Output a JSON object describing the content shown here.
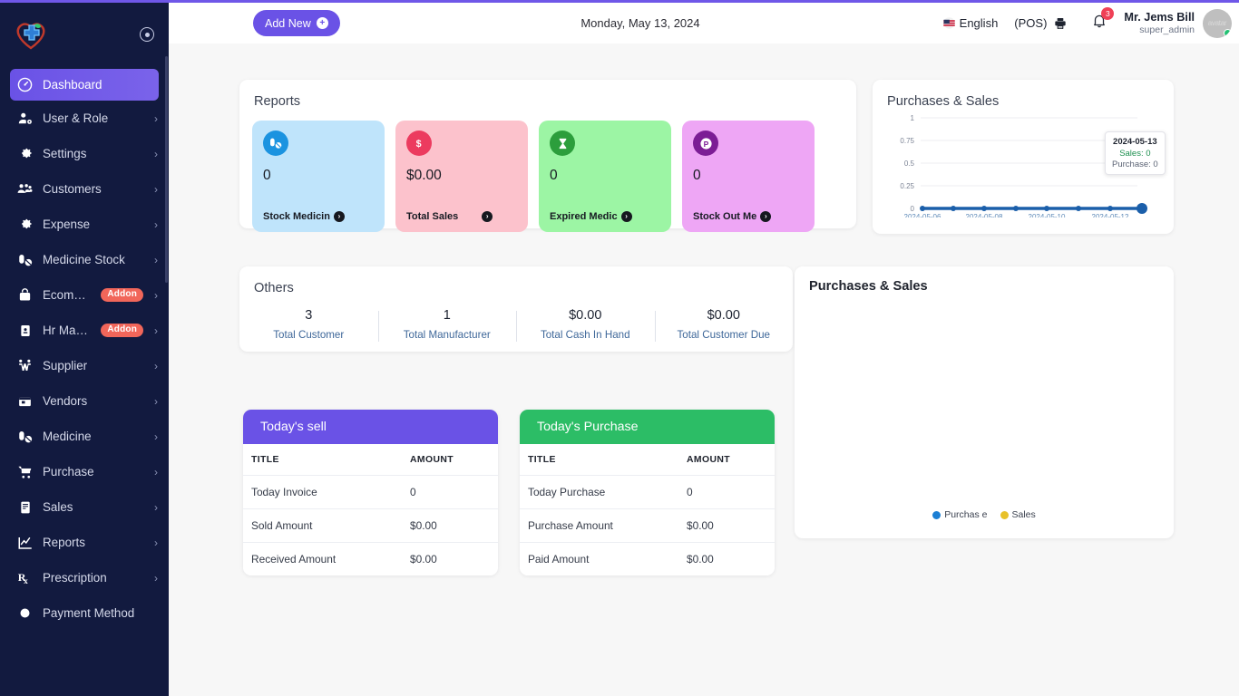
{
  "brand": {
    "accent": "#6a52e6",
    "sidebar_bg": "#121a3f",
    "addon_badge_color": "#f1665a",
    "logo_name": "pharmacy-heart-cross-logo"
  },
  "sidebar": {
    "collapse_icon": "collapse-toggle-icon",
    "items": [
      {
        "label": "Dashboard",
        "icon": "gauge-icon",
        "chevron": false,
        "badge": null,
        "active": true
      },
      {
        "label": "User & Role",
        "icon": "user-gear-icon",
        "chevron": true,
        "badge": null,
        "active": false
      },
      {
        "label": "Settings",
        "icon": "gear-icon",
        "chevron": true,
        "badge": null,
        "active": false
      },
      {
        "label": "Customers",
        "icon": "users-group-icon",
        "chevron": true,
        "badge": null,
        "active": false
      },
      {
        "label": "Expense",
        "icon": "gear-icon",
        "chevron": true,
        "badge": null,
        "active": false
      },
      {
        "label": "Medicine Stock",
        "icon": "pills-icon",
        "chevron": true,
        "badge": null,
        "active": false
      },
      {
        "label": "Ecommerce ...",
        "icon": "lock-bag-icon",
        "chevron": true,
        "badge": "Addon",
        "active": false
      },
      {
        "label": "Hr Manage...",
        "icon": "id-badge-icon",
        "chevron": true,
        "badge": "Addon",
        "active": false
      },
      {
        "label": "Supplier",
        "icon": "supplier-truck-icon",
        "chevron": true,
        "badge": null,
        "active": false
      },
      {
        "label": "Vendors",
        "icon": "store-icon",
        "chevron": true,
        "badge": null,
        "active": false
      },
      {
        "label": "Medicine",
        "icon": "pills-icon",
        "chevron": true,
        "badge": null,
        "active": false
      },
      {
        "label": "Purchase",
        "icon": "shopping-cart-icon",
        "chevron": true,
        "badge": null,
        "active": false
      },
      {
        "label": "Sales",
        "icon": "invoice-icon",
        "chevron": true,
        "badge": null,
        "active": false
      },
      {
        "label": "Reports",
        "icon": "line-chart-icon",
        "chevron": true,
        "badge": null,
        "active": false
      },
      {
        "label": "Prescription",
        "icon": "rx-icon",
        "chevron": true,
        "badge": null,
        "active": false
      },
      {
        "label": "Payment Method",
        "icon": "circle-icon",
        "chevron": false,
        "badge": null,
        "active": false
      }
    ]
  },
  "header": {
    "add_new_label": "Add New",
    "add_new_icon": "plus-circle-icon",
    "date": "Monday, May 13, 2024",
    "language": "English",
    "language_icon": "flag-icon",
    "pos_label": "(POS)",
    "printer_icon": "printer-icon",
    "bell_icon": "bell-icon",
    "notification_count": "3",
    "user_name": "Mr. Jems Bill",
    "user_role": "super_admin",
    "avatar_text": "avatar",
    "avatar_status": "online"
  },
  "reports": {
    "title": "Reports",
    "tiles": [
      {
        "value": "0",
        "label": "Stock Medicin",
        "icon": "pills-icon",
        "bg": "#bfe4fb",
        "icon_bg": "#1b93e0"
      },
      {
        "value": "$0.00",
        "label": "Total Sales",
        "icon": "dollar-icon",
        "bg": "#fcc2cc",
        "icon_bg": "#ec3b5f"
      },
      {
        "value": "0",
        "label": "Expired Medic",
        "icon": "hourglass-icon",
        "bg": "#9cf5a4",
        "icon_bg": "#2c9e3c"
      },
      {
        "value": "0",
        "label": "Stock Out Me",
        "icon": "p-circle-icon",
        "bg": "#eea6f5",
        "icon_bg": "#7c1d95"
      }
    ]
  },
  "others": {
    "title": "Others",
    "stats": [
      {
        "value": "3",
        "label": "Total Customer"
      },
      {
        "value": "1",
        "label": "Total Manufacturer"
      },
      {
        "value": "$0.00",
        "label": "Total Cash In Hand"
      },
      {
        "value": "$0.00",
        "label": "Total Customer Due"
      }
    ]
  },
  "today_sell": {
    "title": "Today's sell",
    "columns": [
      "TITLE",
      "AMOUNT"
    ],
    "rows": [
      [
        "Today Invoice",
        "0"
      ],
      [
        "Sold Amount",
        "$0.00"
      ],
      [
        "Received Amount",
        "$0.00"
      ]
    ]
  },
  "today_purchase": {
    "title": "Today's Purchase",
    "columns": [
      "TITLE",
      "AMOUNT"
    ],
    "rows": [
      [
        "Today Purchase",
        "0"
      ],
      [
        "Purchase Amount",
        "$0.00"
      ],
      [
        "Paid Amount",
        "$0.00"
      ]
    ]
  },
  "pie_panel": {
    "title": "Purchases & Sales",
    "legend": [
      {
        "label": "Purchas e",
        "color": "#1b7fd4"
      },
      {
        "label": "Sales",
        "color": "#e8c12a"
      }
    ]
  },
  "chart_data": [
    {
      "type": "line",
      "title": "Purchases & Sales",
      "x": [
        "2024-05-06",
        "2024-05-07",
        "2024-05-08",
        "2024-05-09",
        "2024-05-10",
        "2024-05-11",
        "2024-05-12",
        "2024-05-13"
      ],
      "xtick_labels": [
        "2024-05-06",
        "2024-05-08",
        "2024-05-10",
        "2024-05-12"
      ],
      "ytick_labels": [
        "0",
        "0.25",
        "0.5",
        "0.75",
        "1"
      ],
      "ylim": [
        0,
        1
      ],
      "grid": true,
      "legend": "none",
      "xlabel": "",
      "ylabel": "",
      "series": [
        {
          "name": "Sales",
          "values": [
            0,
            0,
            0,
            0,
            0,
            0,
            0,
            0
          ],
          "color": "#1b5faa"
        },
        {
          "name": "Purchase",
          "values": [
            0,
            0,
            0,
            0,
            0,
            0,
            0,
            0
          ],
          "color": "#1b5faa"
        }
      ],
      "tooltip": {
        "date": "2024-05-13",
        "sales": "Sales: 0",
        "purchase": "Purchase: 0"
      }
    },
    {
      "type": "pie",
      "title": "Purchases & Sales",
      "labels": [
        "Purchas e",
        "Sales"
      ],
      "values": [
        0,
        0
      ],
      "colors": [
        "#1b7fd4",
        "#e8c12a"
      ],
      "legend": "bottom",
      "empty": true
    }
  ]
}
